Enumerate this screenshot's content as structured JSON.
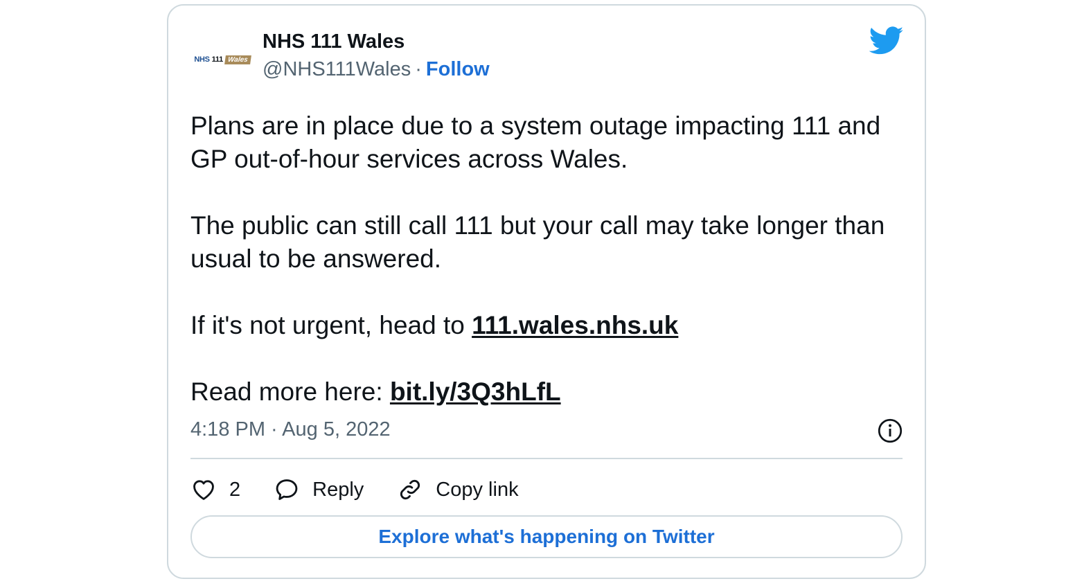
{
  "author": {
    "display_name": "NHS 111 Wales",
    "handle": "@NHS111Wales",
    "separator": "·",
    "follow_label": "Follow",
    "logo": {
      "nhs": "NHS",
      "num": "111",
      "wales": "Wales"
    }
  },
  "tweet": {
    "paragraph_1": "Plans are in place due to a system outage impacting 111 and GP out-of-hour services across Wales.",
    "paragraph_2": "The public can still call 111 but your call may take longer than usual to be answered.",
    "paragraph_3_prefix": "If it's not urgent, head to ",
    "paragraph_3_link": "111.wales.nhs.uk",
    "paragraph_4_prefix": "Read more here: ",
    "paragraph_4_link": "bit.ly/3Q3hLfL",
    "timestamp": "4:18 PM · Aug 5, 2022"
  },
  "actions": {
    "like_count": "2",
    "reply_label": "Reply",
    "copy_link_label": "Copy link"
  },
  "explore_label": "Explore what's happening on Twitter",
  "icons": {
    "brand": "twitter-bird-icon",
    "info": "info-icon",
    "like": "heart-icon",
    "reply": "speech-bubble-icon",
    "copy": "link-icon"
  },
  "colors": {
    "accent": "#1d6fd6",
    "twitter_blue": "#1d9bf0",
    "border": "#cfd9de",
    "muted_text": "#536471"
  }
}
